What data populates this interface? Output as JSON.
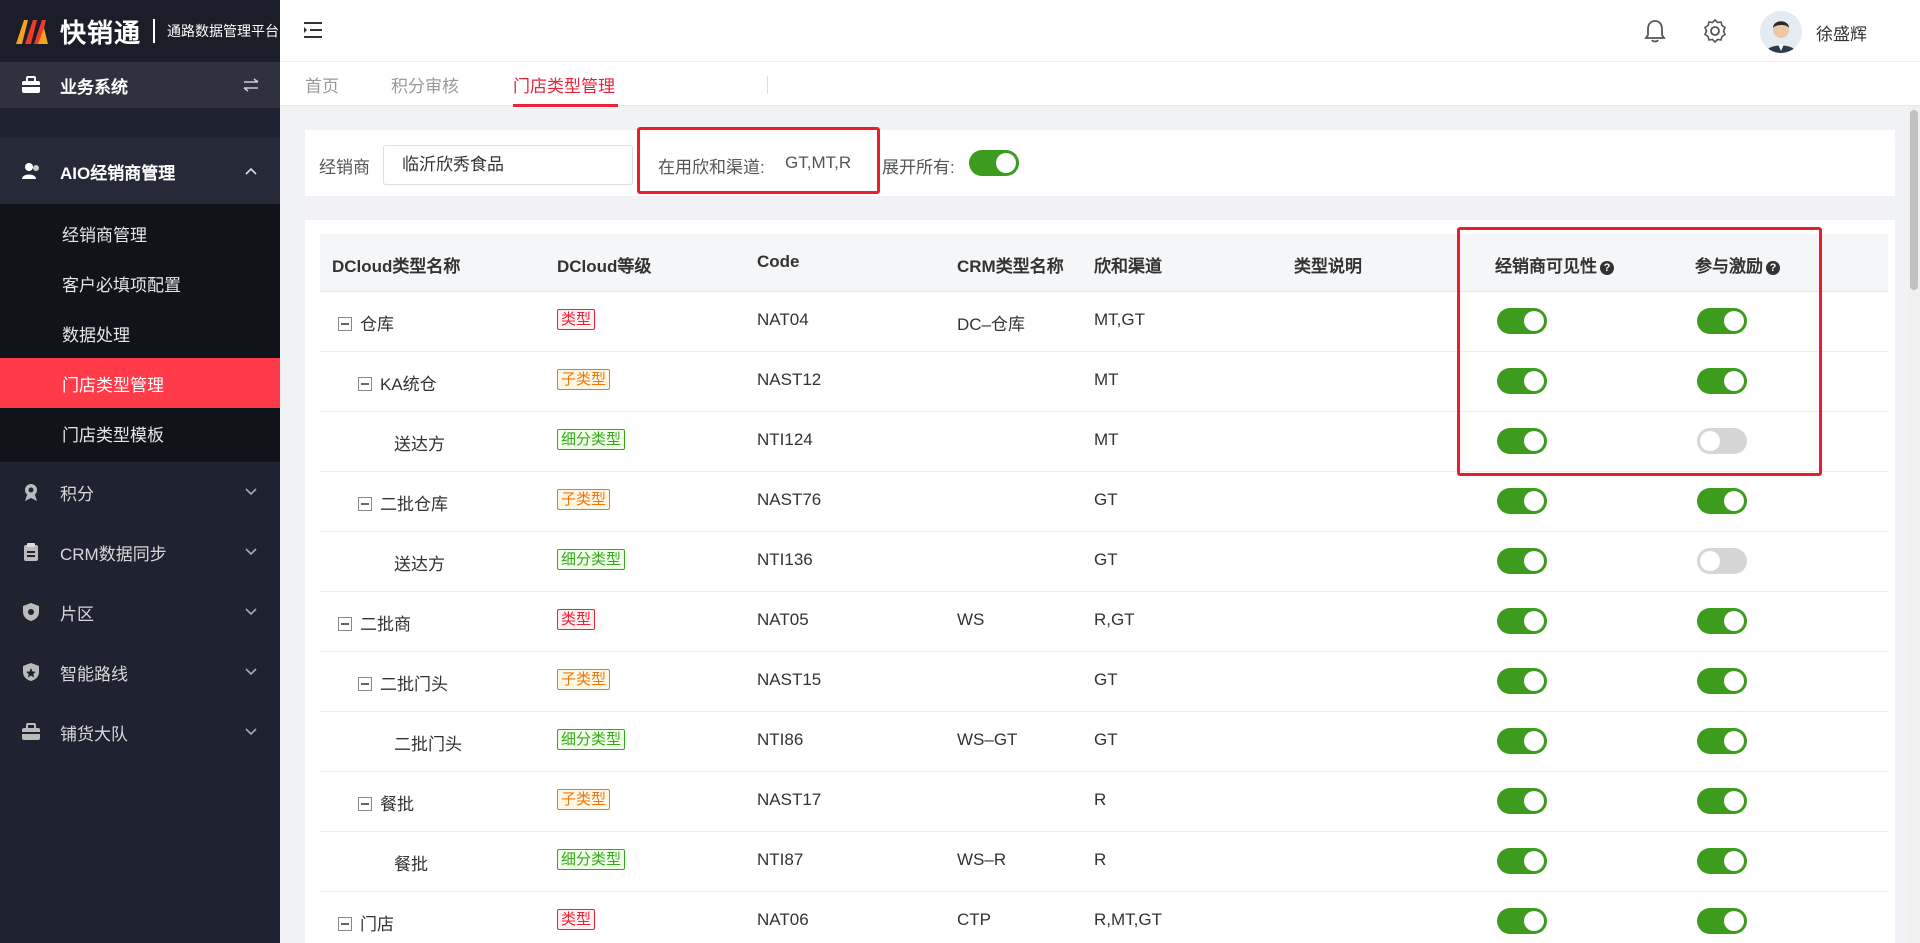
{
  "brand": {
    "name": "快销通",
    "subtitle": "通路数据管理平台"
  },
  "sidebar": {
    "business": "业务系统",
    "aio": "AIO经销商管理",
    "sub_items": [
      "经销商管理",
      "客户必填项配置",
      "数据处理",
      "门店类型管理",
      "门店类型模板"
    ],
    "active_sub": "门店类型管理",
    "menus": [
      "积分",
      "CRM数据同步",
      "片区",
      "智能路线",
      "铺货大队"
    ]
  },
  "header": {
    "username": "徐盛辉"
  },
  "tabs": [
    "首页",
    "积分审核",
    "门店类型管理"
  ],
  "filter": {
    "dealer_label": "经销商",
    "dealer_value": "临沂欣秀食品",
    "channels_label": "在用欣和渠道:",
    "channels_value": "GT,MT,R",
    "expand_label": "展开所有:",
    "expand_all": true
  },
  "table": {
    "headers": [
      "DCloud类型名称",
      "DCloud等级",
      "Code",
      "CRM类型名称",
      "欣和渠道",
      "类型说明",
      "经销商可见性",
      "参与激励"
    ],
    "rows": [
      {
        "name": "仓库",
        "level": "类型",
        "lvl": 1,
        "indent": 0,
        "toggle": true,
        "code": "NAT04",
        "crm": "DC–仓库",
        "channel": "MT,GT",
        "desc": "",
        "visible": true,
        "incentive": true
      },
      {
        "name": "KA统仓",
        "level": "子类型",
        "lvl": 2,
        "indent": 1,
        "toggle": true,
        "code": "NAST12",
        "crm": "",
        "channel": "MT",
        "desc": "",
        "visible": true,
        "incentive": true
      },
      {
        "name": "送达方",
        "level": "细分类型",
        "lvl": 3,
        "indent": 2,
        "toggle": false,
        "code": "NTI124",
        "crm": "",
        "channel": "MT",
        "desc": "",
        "visible": true,
        "incentive": false
      },
      {
        "name": "二批仓库",
        "level": "子类型",
        "lvl": 2,
        "indent": 1,
        "toggle": true,
        "code": "NAST76",
        "crm": "",
        "channel": "GT",
        "desc": "",
        "visible": true,
        "incentive": true
      },
      {
        "name": "送达方",
        "level": "细分类型",
        "lvl": 3,
        "indent": 2,
        "toggle": false,
        "code": "NTI136",
        "crm": "",
        "channel": "GT",
        "desc": "",
        "visible": true,
        "incentive": false
      },
      {
        "name": "二批商",
        "level": "类型",
        "lvl": 1,
        "indent": 0,
        "toggle": true,
        "code": "NAT05",
        "crm": "WS",
        "channel": "R,GT",
        "desc": "",
        "visible": true,
        "incentive": true
      },
      {
        "name": "二批门头",
        "level": "子类型",
        "lvl": 2,
        "indent": 1,
        "toggle": true,
        "code": "NAST15",
        "crm": "",
        "channel": "GT",
        "desc": "",
        "visible": true,
        "incentive": true
      },
      {
        "name": "二批门头",
        "level": "细分类型",
        "lvl": 3,
        "indent": 2,
        "toggle": false,
        "code": "NTI86",
        "crm": "WS–GT",
        "channel": "GT",
        "desc": "",
        "visible": true,
        "incentive": true
      },
      {
        "name": "餐批",
        "level": "子类型",
        "lvl": 2,
        "indent": 1,
        "toggle": true,
        "code": "NAST17",
        "crm": "",
        "channel": "R",
        "desc": "",
        "visible": true,
        "incentive": true
      },
      {
        "name": "餐批",
        "level": "细分类型",
        "lvl": 3,
        "indent": 2,
        "toggle": false,
        "code": "NTI87",
        "crm": "WS–R",
        "channel": "R",
        "desc": "",
        "visible": true,
        "incentive": true
      },
      {
        "name": "门店",
        "level": "类型",
        "lvl": 1,
        "indent": 0,
        "toggle": true,
        "code": "NAT06",
        "crm": "CTP",
        "channel": "R,MT,GT",
        "desc": "",
        "visible": true,
        "incentive": true
      }
    ]
  },
  "colors": {
    "accent": "#e8243a",
    "switch_on": "#3d9b1e",
    "sidebar": "#1f2230",
    "highlight_box": "#ee1c2a"
  }
}
